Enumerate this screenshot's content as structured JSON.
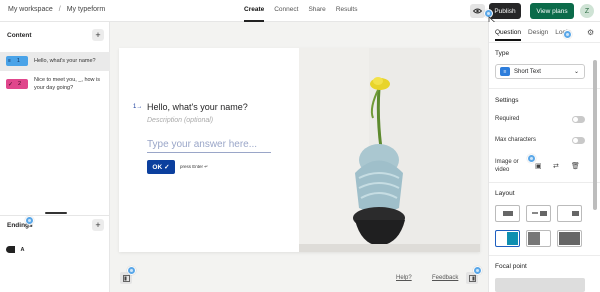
{
  "header": {
    "workspace": "My workspace",
    "separator": "/",
    "form_name": "My typeform",
    "tabs": [
      {
        "label": "Create",
        "active": true
      },
      {
        "label": "Connect",
        "active": false
      },
      {
        "label": "Share",
        "active": false
      },
      {
        "label": "Results",
        "active": false
      }
    ],
    "publish_label": "Publish",
    "view_plans_label": "View plans",
    "avatar_initial": "Z"
  },
  "sidebar": {
    "content_label": "Content",
    "add_symbol": "+",
    "questions": [
      {
        "number": "1",
        "text": "Hello, what's your name?",
        "color": "#4aa3e8",
        "icon": "short-text-icon"
      },
      {
        "number": "2",
        "text": "Nice to meet you, _, how is your day going?",
        "color": "#e0468c",
        "icon": "checkmark-icon"
      }
    ],
    "endings_label": "Endings",
    "ending_item": "A"
  },
  "canvas": {
    "question_number": "1",
    "arrow": "→",
    "question_title": "Hello, what's your name?",
    "description_placeholder": "Description (optional)",
    "answer_placeholder": "Type your answer here...",
    "ok_label": "OK",
    "ok_check": "✓",
    "press_enter": "press Enter ↵"
  },
  "footer": {
    "help_label": "Help?",
    "feedback_label": "Feedback"
  },
  "right_panel": {
    "tabs": [
      {
        "label": "Question",
        "active": true
      },
      {
        "label": "Design",
        "active": false
      },
      {
        "label": "Logic",
        "active": false
      }
    ],
    "type_section": "Type",
    "type_value": "Short Text",
    "settings_section": "Settings",
    "required_label": "Required",
    "max_chars_label": "Max characters",
    "image_video_label": "Image or video",
    "layout_section": "Layout",
    "focal_point_section": "Focal point"
  },
  "colors": {
    "publish_bg": "#262627",
    "view_plans_bg": "#0b6b4a",
    "ok_bg": "#0b3f9e",
    "hotspot": "#5aa7e8"
  }
}
